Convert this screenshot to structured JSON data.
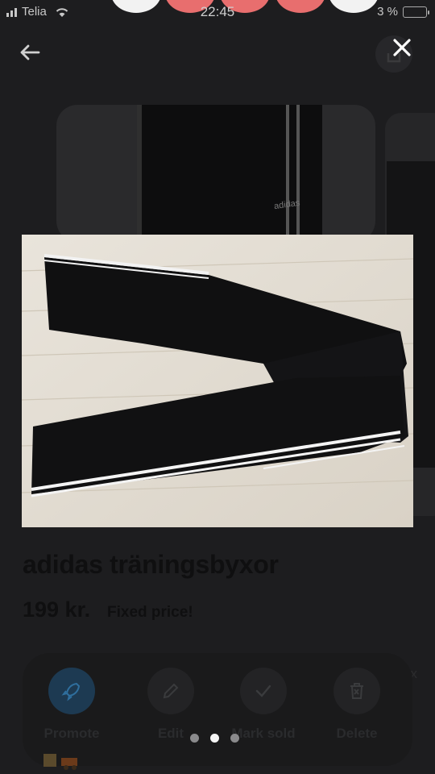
{
  "status_bar": {
    "carrier": "Telia",
    "time": "22:45",
    "battery": "3 %"
  },
  "listing": {
    "title": "adidas träningsbyxor",
    "price": "199 kr.",
    "price_note": "Fixed price!",
    "side_text": "ex"
  },
  "bg_photo": {
    "logo_text": "adidas"
  },
  "actions": [
    {
      "label": "Promote",
      "icon": "rocket-icon"
    },
    {
      "label": "Edit",
      "icon": "pencil-icon"
    },
    {
      "label": "Mark sold",
      "icon": "checkmark-icon"
    },
    {
      "label": "Delete",
      "icon": "trash-icon"
    }
  ],
  "pager": {
    "total": 3,
    "active": 2
  },
  "colors": {
    "overlay_bg": "#1d1d1f",
    "action_bar": "#1a1a1b",
    "promote_circle": "#1d3a52",
    "active_dot": "#f5f5f5"
  }
}
